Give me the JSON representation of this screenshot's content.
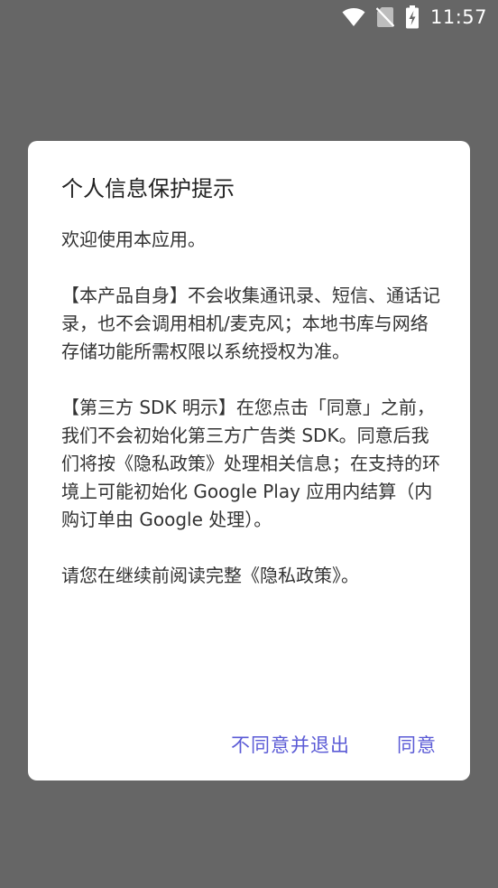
{
  "status_bar": {
    "time": "11:57",
    "icons": [
      "wifi-icon",
      "no-sim-icon",
      "battery-charging-icon"
    ]
  },
  "dialog": {
    "title": "个人信息保护提示",
    "body": "欢迎使用本应用。\n\n【本产品自身】不会收集通讯录、短信、通话记录，也不会调用相机/麦克风；本地书库与网络存储功能所需权限以系统授权为准。\n\n【第三方 SDK 明示】在您点击「同意」之前，我们不会初始化第三方广告类 SDK。同意后我们将按《隐私政策》处理相关信息；在支持的环境上可能初始化 Google Play 应用内结算（内购订单由 Google 处理）。\n\n请您在继续前阅读完整《隐私政策》。",
    "decline_label": "不同意并退出",
    "accept_label": "同意"
  },
  "colors": {
    "scrim": "#666666",
    "dialog_bg": "#ffffff",
    "accent": "#5b5bd6",
    "title_text": "#222222",
    "body_text": "#333333"
  }
}
